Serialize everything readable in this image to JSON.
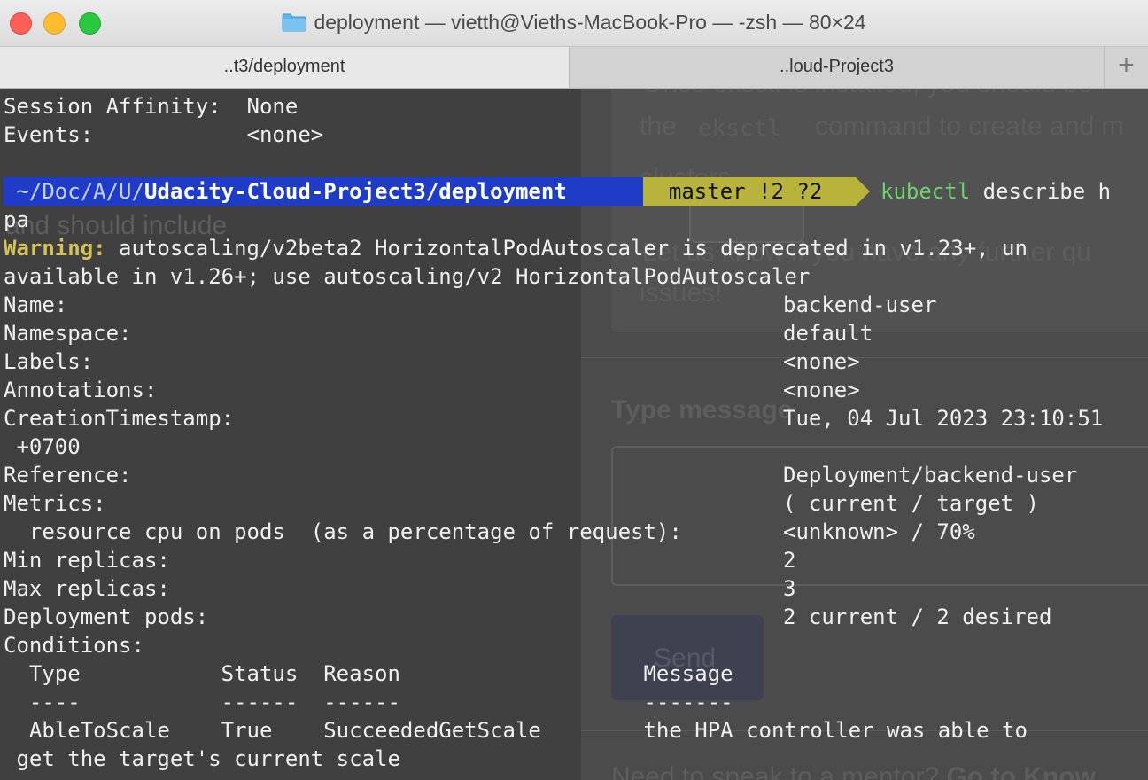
{
  "window": {
    "title": "deployment — vietth@Vieths-MacBook-Pro — -zsh — 80×24"
  },
  "tabs": [
    {
      "label": "..t3/deployment",
      "active": true
    },
    {
      "label": "..loud-Project3",
      "active": false
    }
  ],
  "new_tab_label": "+",
  "background_page": {
    "line1": "Once eksctl is installed, you should be",
    "line2_pre": "the",
    "code": "eksctl",
    "line2_post": "command to create and m",
    "line3": "clusters",
    "line4": "and should include",
    "line5": "Let us know if you have any further qu",
    "line6": "issues!",
    "type_message": "Type message",
    "send": "Send",
    "footer_pre": "Need to speak to a mentor?",
    "footer_link": "Go to Know"
  },
  "terminal": {
    "line_session": "Session Affinity:  None",
    "line_events": "Events:            <none>",
    "prompt": {
      "path_prefix": " ~/Doc/A/U/",
      "path_bold": "Udacity-Cloud-Project3/deployment ",
      "git": "  master !2 ?2 ",
      "cmd_name": "kubectl",
      "cmd_rest": " describe h"
    },
    "line_pa": "pa",
    "warning_label": "Warning:",
    "warning_text": " autoscaling/v2beta2 HorizontalPodAutoscaler is deprecated in v1.23+, un",
    "warning_cont": "available in v1.26+; use autoscaling/v2 HorizontalPodAutoscaler",
    "fields": {
      "name_k": "Name:",
      "name_v": "backend-user",
      "ns_k": "Namespace:",
      "ns_v": "default",
      "labels_k": "Labels:",
      "labels_v": "<none>",
      "annot_k": "Annotations:",
      "annot_v": "<none>",
      "created_k": "CreationTimestamp:",
      "created_v": "Tue, 04 Jul 2023 23:10:51",
      "created_cont": " +0700",
      "ref_k": "Reference:",
      "ref_v": "Deployment/backend-user",
      "metrics_k": "Metrics:",
      "metrics_v": "( current / target )",
      "res_k": "  resource cpu on pods  (as a percentage of request):",
      "res_v": "<unknown> / 70%",
      "min_k": "Min replicas:",
      "min_v": "2",
      "max_k": "Max replicas:",
      "max_v": "3",
      "pods_k": "Deployment pods:",
      "pods_v": "2 current / 2 desired",
      "cond_k": "Conditions:"
    },
    "conditions": {
      "header": "  Type           Status  Reason                   Message",
      "underline": "  ----           ------  ------                   -------",
      "row1": "  AbleToScale    True    SucceededGetScale        the HPA controller was able to",
      "row1_cont": " get the target's current scale"
    }
  }
}
